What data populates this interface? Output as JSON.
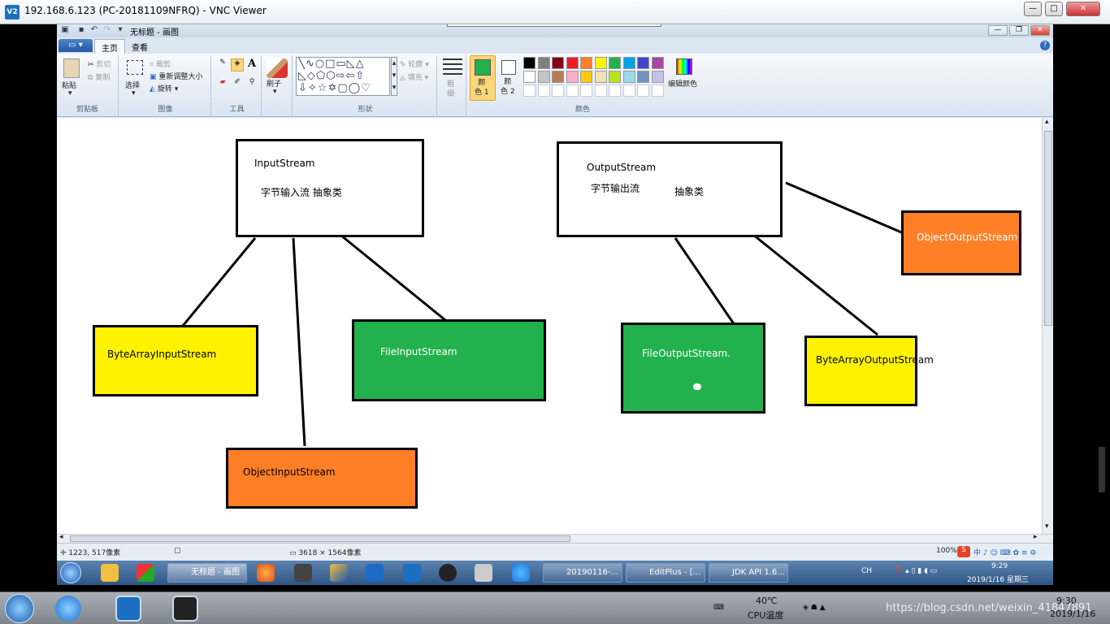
{
  "vnc": {
    "logo": "V2",
    "title": "192.168.6.123 (PC-20181109NFRQ) - VNC Viewer",
    "btn_min": "—",
    "btn_max": "□",
    "btn_close": "✕"
  },
  "paint": {
    "title": "无标题 - 画图",
    "tabs": {
      "home": "主页",
      "view": "查看"
    },
    "help": "?",
    "clipboard": {
      "paste": "粘贴",
      "cut": "剪切",
      "copy": "复制",
      "label": "剪贴板"
    },
    "image": {
      "select": "选择",
      "crop": "裁剪",
      "resize": "重新调整大小",
      "rotate": "旋转",
      "label": "图像"
    },
    "tools": {
      "label": "工具",
      "text_tool": "A"
    },
    "brushes": {
      "label": "刷子"
    },
    "shapes": {
      "outline": "轮廓",
      "fill": "填充",
      "label": "形状"
    },
    "size": {
      "label": "粗\n细"
    },
    "colors": {
      "color1": "颜\n色 1",
      "color2": "颜\n色 2",
      "edit": "编辑颜色",
      "label": "颜色",
      "color1_value": "#22b14c",
      "color2_value": "#ffffff",
      "palette_row1": [
        "#000000",
        "#7f7f7f",
        "#880015",
        "#ed1c24",
        "#ff7f27",
        "#fff200",
        "#22b14c",
        "#00a2e8",
        "#3f48cc",
        "#a349a4"
      ],
      "palette_row2": [
        "#ffffff",
        "#c3c3c3",
        "#b97a57",
        "#ffaec9",
        "#ffc90e",
        "#efe4b0",
        "#b5e61d",
        "#99d9ea",
        "#7092be",
        "#c8bfe7"
      ]
    },
    "status": {
      "cursor_pos": "1223, 517像素",
      "image_size": "3618 × 1564像素",
      "zoom": "100%"
    }
  },
  "diagram": {
    "input_stream": {
      "title": "InputStream",
      "desc": "字节输入流 抽象类"
    },
    "output_stream": {
      "title": "OutputStream",
      "desc1": "字节输出流",
      "desc2": "抽象类"
    },
    "byte_array_input": "ByteArrayInputStream",
    "file_input": "FileInputStream",
    "object_input": "ObjectInputStream",
    "file_output": "FileOutputStream.",
    "byte_array_output": "ByteArrayOutputStream",
    "object_output": "ObjectOutputStream",
    "colors": {
      "yellow": "#fff200",
      "green": "#22b14c",
      "orange": "#ff7f27"
    }
  },
  "remote_taskbar": {
    "apps": [
      {
        "label": "无标题 - 画图"
      },
      {
        "label": "20190116-..."
      },
      {
        "label": "EditPlus - [..."
      },
      {
        "label": "JDK API 1.6..."
      }
    ],
    "tray_lang": "CH",
    "time": "9:29",
    "date": "2019/1/16 星期三"
  },
  "local_taskbar": {
    "temp": "40℃",
    "temp_label": "CPU温度",
    "time": "9:30",
    "date": "2019/1/16",
    "watermark": "https://blog.csdn.net/weixin_41847891"
  }
}
